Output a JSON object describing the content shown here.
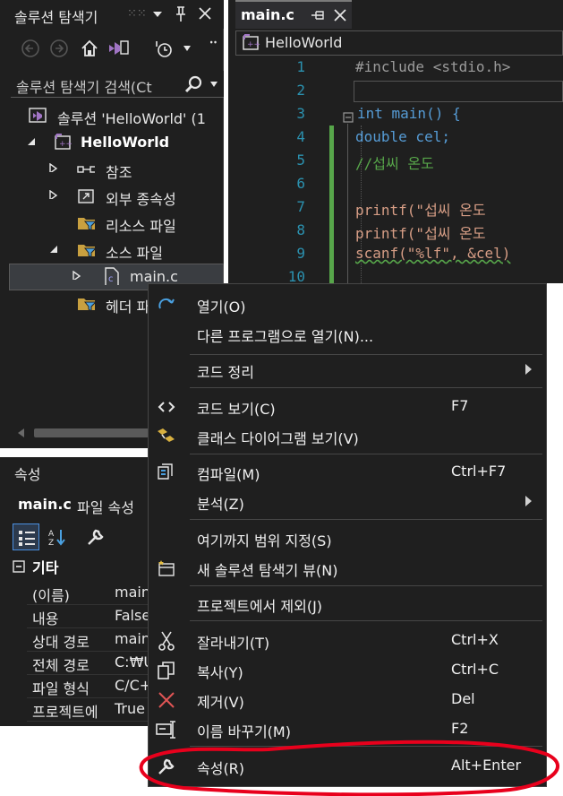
{
  "solution_explorer": {
    "title": "솔루션 탐색기",
    "search_placeholder": "솔루션 탐색기 검색(Ct",
    "tree": {
      "solution": "솔루션 'HelloWorld' (1",
      "project": "HelloWorld",
      "references": "참조",
      "external_deps": "외부 종속성",
      "resource_files": "리소스 파일",
      "source_files": "소스 파일",
      "main_c": "main.c",
      "header_files": "헤더 파"
    }
  },
  "properties": {
    "title": "속성",
    "object_name": "main.c",
    "object_type": "파일 속성",
    "category": "기타",
    "rows": [
      {
        "key": "(이름)",
        "value": "main"
      },
      {
        "key": "내용",
        "value": "False"
      },
      {
        "key": "상대 경로",
        "value": "main"
      },
      {
        "key": "전체 경로",
        "value": "C:₩U"
      },
      {
        "key": "파일 형식",
        "value": "C/C+"
      },
      {
        "key": "프로젝트에",
        "value": "True"
      }
    ]
  },
  "editor": {
    "tab_label": "main.c",
    "nav_label": "HelloWorld",
    "lines": [
      {
        "n": "1",
        "code": "#include <stdio.h>"
      },
      {
        "n": "2",
        "code": ""
      },
      {
        "n": "3",
        "code": "int main() {"
      },
      {
        "n": "4",
        "code": "    double cel;"
      },
      {
        "n": "5",
        "code": "    //섭씨 온도"
      },
      {
        "n": "6",
        "code": ""
      },
      {
        "n": "7",
        "code": "    printf(\"섭씨 온도"
      },
      {
        "n": "8",
        "code": "    printf(\"섭씨 온도"
      },
      {
        "n": "9",
        "code": "    scanf(\"%lf\", &cel)"
      },
      {
        "n": "10",
        "code": ""
      }
    ]
  },
  "context_menu": {
    "items": {
      "open": {
        "label": "열기(O)",
        "shortcut": ""
      },
      "open_with": {
        "label": "다른 프로그램으로 열기(N)...",
        "shortcut": ""
      },
      "code_cleanup": {
        "label": "코드 정리",
        "shortcut": ""
      },
      "view_code": {
        "label": "코드 보기(C)",
        "shortcut": "F7"
      },
      "class_diagram": {
        "label": "클래스 다이어그램 보기(V)",
        "shortcut": ""
      },
      "compile": {
        "label": "컴파일(M)",
        "shortcut": "Ctrl+F7"
      },
      "analyze": {
        "label": "분석(Z)",
        "shortcut": ""
      },
      "scope_here": {
        "label": "여기까지 범위 지정(S)",
        "shortcut": ""
      },
      "new_view": {
        "label": "새 솔루션 탐색기 뷰(N)",
        "shortcut": ""
      },
      "exclude": {
        "label": "프로젝트에서 제외(J)",
        "shortcut": ""
      },
      "cut": {
        "label": "잘라내기(T)",
        "shortcut": "Ctrl+X"
      },
      "copy": {
        "label": "복사(Y)",
        "shortcut": "Ctrl+C"
      },
      "remove": {
        "label": "제거(V)",
        "shortcut": "Del"
      },
      "rename": {
        "label": "이름 바꾸기(M)",
        "shortcut": "F2"
      },
      "properties": {
        "label": "속성(R)",
        "shortcut": "Alt+Enter"
      }
    }
  },
  "colors": {
    "background": "#1f1f1f",
    "annotation_red": "#e8001c",
    "git_added_green": "#57a64a",
    "keyword_blue": "#569cd6",
    "comment_green": "#57a64a",
    "string_orange": "#d69d85"
  }
}
